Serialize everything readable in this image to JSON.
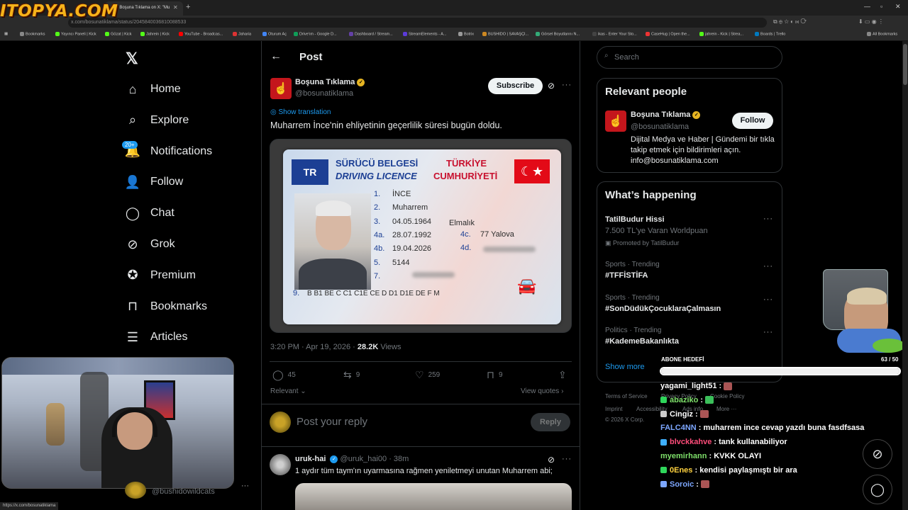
{
  "browser": {
    "brand": "ITOPYA.COM",
    "tab_title": "(20) Boşuna Tıklama on X: \"Mu",
    "url": "x.com/bosunatiklama/status/2045840036810088533",
    "status_url": "https://x.com/bosunatiklama",
    "bookmarks": [
      "Bookmarks",
      "Yayıncı Paneli | Kick",
      "Gözat | Kick",
      "Jahrein | Kick",
      "YouTube - Broadcas...",
      "Jaharia",
      "Oturum Aç",
      "Drive'ım - Google D...",
      "Dashboard / Stream...",
      "StreamElements - A...",
      "Botrix",
      "BUSHIDO | SAVAŞÇI...",
      "Görsel Boyutlarını N...",
      "ikas - Enter Your Sto...",
      "CaseHug | Open the...",
      "jahrein - Kick | Strea...",
      "Boards | Trello",
      "All Bookmarks"
    ]
  },
  "nav": {
    "items": [
      {
        "label": "Home",
        "icon": "home-icon"
      },
      {
        "label": "Explore",
        "icon": "search-icon"
      },
      {
        "label": "Notifications",
        "icon": "bell-icon"
      },
      {
        "label": "Follow",
        "icon": "person-plus-icon"
      },
      {
        "label": "Chat",
        "icon": "chat-bubble-icon"
      },
      {
        "label": "Grok",
        "icon": "grok-icon"
      },
      {
        "label": "Premium",
        "icon": "verified-badge-icon"
      },
      {
        "label": "Bookmarks",
        "icon": "bookmark-icon"
      },
      {
        "label": "Articles",
        "icon": "article-icon"
      }
    ],
    "notif_badge": "20+"
  },
  "post": {
    "header": "Post",
    "author_name": "Boşuna Tıklama",
    "author_handle": "@bosunatiklama",
    "subscribe": "Subscribe",
    "show_translation": "Show translation",
    "text": "Muharrem İnce'nin ehliyetinin geçerlilik süresi bugün doldu.",
    "license": {
      "country_code": "TR",
      "title_l1": "SÜRÜCÜ BELGESİ",
      "title_l2": "DRIVING LICENCE",
      "title_r1": "TÜRKİYE",
      "title_r2": "CUMHURİYETİ",
      "fields": [
        {
          "num": "1.",
          "value": "İNCE"
        },
        {
          "num": "2.",
          "value": "Muharrem"
        },
        {
          "num": "3.",
          "value": "04.05.1964",
          "extra": "Elmalık"
        },
        {
          "num": "4a.",
          "value": "28.07.1992"
        },
        {
          "num": "4b.",
          "value": "19.04.2026"
        },
        {
          "num": "5.",
          "value": "5144"
        },
        {
          "num": "7.",
          "value": ""
        }
      ],
      "field_4c_label": "4c.",
      "field_4c_value": "77 Yalova",
      "field_4d_label": "4d.",
      "field_9_label": "9.",
      "field_9_value": "B B1 BE C C1 C1E CE D D1 D1E DE F M"
    },
    "time": "3:20 PM · Apr 19, 2026 · ",
    "views_count": "28.2K",
    "views_label": " Views",
    "replies": "45",
    "reposts": "9",
    "likes": "259",
    "bookmarks": "9",
    "relevant": "Relevant",
    "view_quotes": "View quotes",
    "reply_placeholder": "Post your reply",
    "reply_button": "Reply"
  },
  "reply2": {
    "name": "uruk-hai",
    "handle": "@uruk_hai00",
    "time": "· 38m",
    "text": "1 aydır tüm taym'ın uyarmasına rağmen yeniletmeyi unutan Muharrem abi;"
  },
  "account_handle": "@bushidowildcats",
  "sidebar": {
    "search_placeholder": "Search",
    "relevant_title": "Relevant people",
    "person_name": "Boşuna Tıklama",
    "person_handle": "@bosunatiklama",
    "person_bio": "Dijital Medya ve Haber | Gündemi bir tıkla takip etmek için bildirimleri açın. info@bosunatiklama.com",
    "follow": "Follow",
    "happening_title": "What’s happening",
    "trends": [
      {
        "cat": "",
        "name": "TatilBudur Hissi",
        "sub": "7.500 TL'ye Varan Worldpuan"
      },
      {
        "cat": "Sports · Trending",
        "name": "#TFFİSTİFA",
        "sub": ""
      },
      {
        "cat": "Sports · Trending",
        "name": "#SonDüdükÇocuklaraÇalmasın",
        "sub": ""
      },
      {
        "cat": "Politics · Trending",
        "name": "#KademeBakanlıkta",
        "sub": ""
      }
    ],
    "promoted": "Promoted by TatilBudur",
    "show_more": "Show more",
    "footer": [
      "Terms of Service",
      "Privacy Policy",
      "Cookie Policy",
      "Imprint",
      "Accessibility",
      "Ads info",
      "More ···",
      "© 2026 X Corp."
    ]
  },
  "overlay": {
    "goal_label": "ABONE HEDEFİ",
    "goal_count": "63 / 50",
    "goal_progress": 1.0,
    "chat": [
      {
        "user": "yagami_light51",
        "msg": "",
        "color": "#ffffff"
      },
      {
        "user": "abaziko",
        "msg": "",
        "color": "#7ee06a"
      },
      {
        "user": "Cingiz",
        "msg": "",
        "color": "#ffffff"
      },
      {
        "user": "FALC4NN",
        "msg": "muharrem ince cevap yazdı buna fasdfsasa",
        "color": "#7da7ff"
      },
      {
        "user": "blvckkahve",
        "msg": "tank kullanabiliyor",
        "color": "#ff4d7a"
      },
      {
        "user": "myemirhann",
        "msg": "KVKK OLAYI",
        "color": "#7ee06a"
      },
      {
        "user": "0Enes",
        "msg": "kendisi paylaşmıştı bir ara",
        "color": "#ffd23f"
      },
      {
        "user": "Soroic",
        "msg": "",
        "color": "#7da7ff"
      }
    ]
  },
  "colors": {
    "accent": "#1d9bf0",
    "brand_red": "#c4161c",
    "gold_badge": "#e6b422"
  }
}
